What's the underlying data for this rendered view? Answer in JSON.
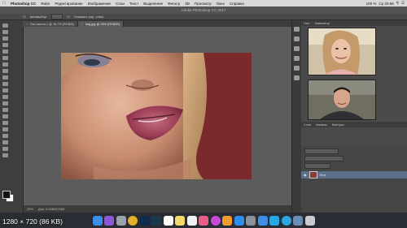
{
  "menubar": {
    "apple_icon": "apple-icon",
    "app_name": "Photoshop CC",
    "items": [
      "Файл",
      "Редактирование",
      "Изображение",
      "Слои",
      "Текст",
      "Выделение",
      "Фильтр",
      "3D",
      "Просмотр",
      "Окно",
      "Справка"
    ],
    "status_text": "Ср 20:58",
    "battery": "100 %"
  },
  "app_title": "Adobe Photoshop CC 2017",
  "options": {
    "auto_select_label": "Автовыбор:",
    "transform_label": "Показать упр. элем."
  },
  "tabs": [
    {
      "label": "Без имени-1 @ 16,7% (RGB/8)"
    },
    {
      "label": "img.jpg @ 25% (RGB/8*)"
    }
  ],
  "canvas": {
    "doc_title": "",
    "zoom": "25%",
    "doc_info": "Док: 5,93М/5,93М"
  },
  "panels": {
    "header_tabs": [
      "Гист",
      "Навигатор"
    ],
    "layers_tabs": [
      "Слои",
      "Каналы",
      "Контуры"
    ],
    "layer_name": "Фон"
  },
  "overlay": {
    "resolution_label": "1280 × 720 (86 KB)"
  },
  "colors": {
    "photo_background": "#7a2a2a",
    "accent_blue": "#5a6f8a"
  },
  "dock_apps": [
    "finder",
    "siri",
    "launchpad",
    "chrome",
    "photoshop",
    "lightroom",
    "calendar",
    "notes",
    "reminders",
    "photos",
    "itunes",
    "ibooks",
    "app-store",
    "system-preferences",
    "finder-2",
    "skype",
    "telegram",
    "mail",
    "trash"
  ]
}
